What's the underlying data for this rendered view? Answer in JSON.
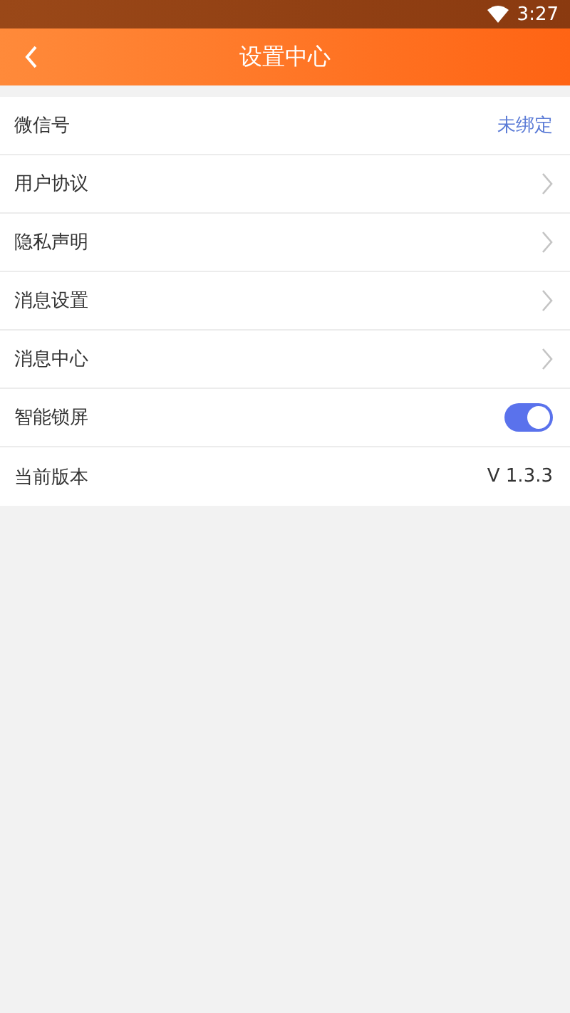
{
  "status_bar": {
    "time": "3:27"
  },
  "header": {
    "title": "设置中心"
  },
  "rows": [
    {
      "kind": "status",
      "label": "微信号",
      "value": "未绑定"
    },
    {
      "kind": "link",
      "label": "用户协议"
    },
    {
      "kind": "link",
      "label": "隐私声明"
    },
    {
      "kind": "link",
      "label": "消息设置"
    },
    {
      "kind": "link",
      "label": "消息中心"
    },
    {
      "kind": "toggle",
      "label": "智能锁屏",
      "on": true
    },
    {
      "kind": "value",
      "label": "当前版本",
      "value": "V 1.3.3"
    }
  ]
}
